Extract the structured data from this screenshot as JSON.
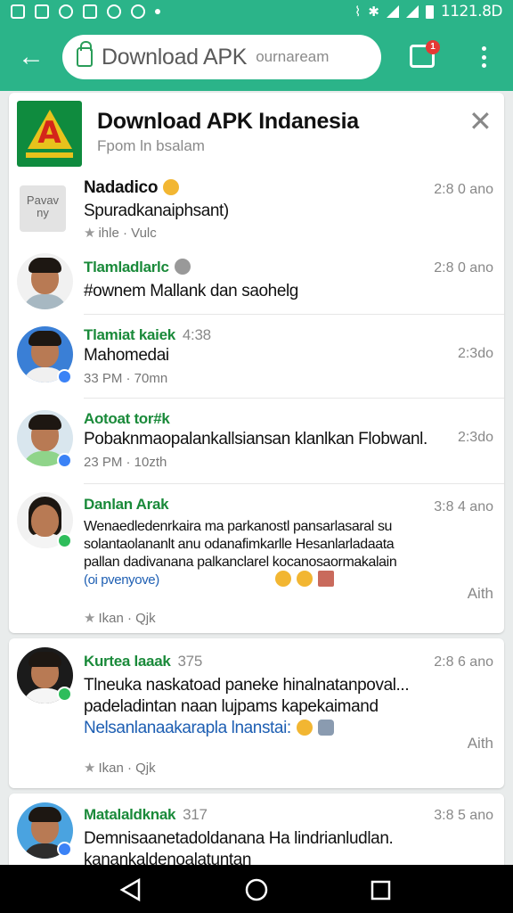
{
  "status_bar": {
    "time": "1121.8D"
  },
  "toolbar": {
    "back_icon": "arrow-left-icon",
    "url_title": "Download APK",
    "url_domain": "ournaream",
    "chat_badge": "1",
    "colors": {
      "bar": "#2bb489",
      "lock": "#2a9d59",
      "badge": "#e53935"
    }
  },
  "header": {
    "title": "Download APK Indanesia",
    "subtitle": "Fpom ln bsalam",
    "logo_letter": "A",
    "logo_caption": "DOWNLOAD APK"
  },
  "messages": [
    {
      "name": "Nadadico",
      "text": "Spuradkanaiphsant)",
      "meta": "ihle · Vulc",
      "time": "2:8 0 ano",
      "avatar_text": "Pavav ny"
    },
    {
      "name": "Tlamladlarlc",
      "text": "#ownem Mallank dan saohelg",
      "time": "2:8 0 ano"
    },
    {
      "name": "Tlamiat kaiek",
      "extra": "4:38",
      "text": "Mahomedai",
      "meta": "33 PM · 70mn",
      "time": "2:3do"
    },
    {
      "name": "Aotoat tor#k",
      "text": "Pobaknmaopalankallsiansan klanlkan Flobwanl.",
      "meta": "23 PM · 10zth",
      "time": "2:3do"
    },
    {
      "name": "Danlan Arak",
      "line1": "Wenaedledenrkaira ma parkanostl pansarlasaral su",
      "line2": "solantaolananlt anu odanafimkarlle Hesanlarladaata",
      "line3": "pallan dadivanana palkanclarel kocanosaormakalain",
      "line4": "(oi pvenyove)",
      "reply": "Aith",
      "meta": "Ikan · Qjk",
      "time": "3:8 4 ano"
    },
    {
      "name": "Kurtea laaak",
      "extra": "375",
      "line1": "Tlneuka naskatoad paneke hinalnatanpoval...",
      "line2": "padeladintan naan lujpams kapekaimand",
      "line3": "Nelsanlanaakarapla lnanstai:",
      "reply": "Aith",
      "meta": "Ikan · Qjk",
      "time": "2:8 6 ano"
    },
    {
      "name": "Matalaldknak",
      "extra": "317",
      "line1": "Demnisaanetadoldanana Ha lindrianludlan.",
      "line2": "kanankaldenoalatuntan",
      "time": "3:8 5 ano"
    }
  ],
  "nav": {
    "back": "back-triangle-icon",
    "home": "home-circle-icon",
    "recents": "recents-square-icon"
  }
}
